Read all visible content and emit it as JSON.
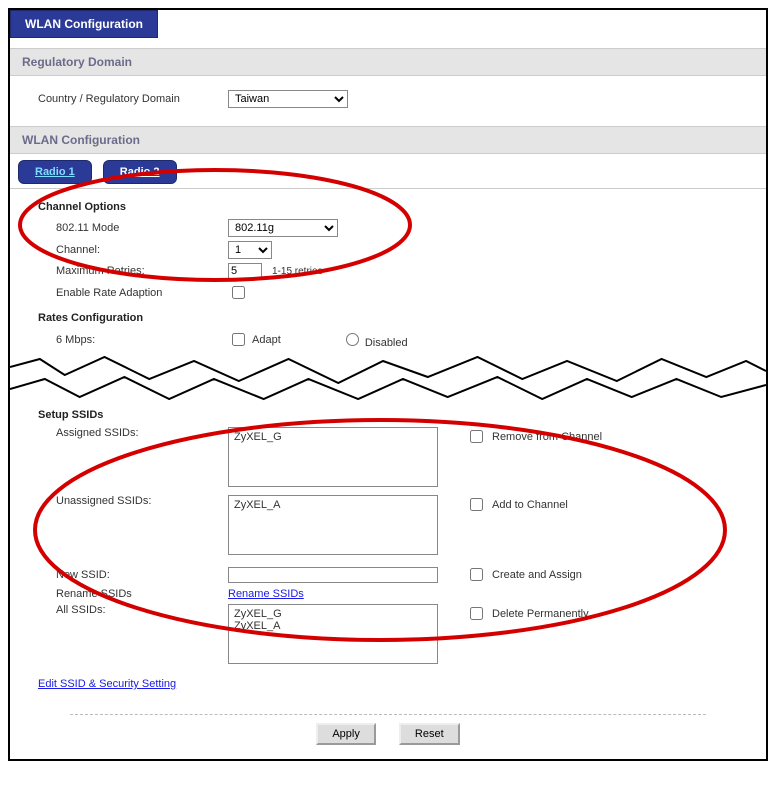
{
  "main_tab": "WLAN Configuration",
  "regulatory": {
    "header": "Regulatory Domain",
    "country_label": "Country / Regulatory Domain",
    "country_value": "Taiwan"
  },
  "wlan": {
    "header": "WLAN Configuration",
    "tabs": {
      "radio1": "Radio 1",
      "radio2": "Radio 2"
    },
    "channel_options": {
      "header": "Channel Options",
      "mode_label": "802.11 Mode",
      "mode_value": "802.11g",
      "channel_label": "Channel:",
      "channel_value": "1",
      "max_retries_label": "Maximum Retries:",
      "max_retries_value": "5",
      "max_retries_hint": "1-15 retries",
      "rate_adapt_label": "Enable Rate Adaption"
    },
    "rates": {
      "header": "Rates Configuration",
      "rate6_label": "6 Mbps:",
      "adapt_label": "Adapt",
      "disabled_label": "Disabled"
    },
    "ssids": {
      "header": "Setup SSIDs",
      "assigned_label": "Assigned SSIDs:",
      "assigned_list": "ZyXEL_G",
      "remove_label": "Remove from Channel",
      "unassigned_label": "Unassigned SSIDs:",
      "unassigned_list": "ZyXEL_A",
      "add_label": "Add to Channel",
      "new_label": "New SSID:",
      "new_value": "",
      "create_label": "Create and Assign",
      "rename_label": "Rename SSIDs",
      "rename_link": "Rename SSIDs",
      "all_label": "All SSIDs:",
      "all_list": "ZyXEL_G\nZyXEL_A",
      "delete_label": "Delete Permanently",
      "edit_link": "Edit SSID & Security Setting"
    }
  },
  "buttons": {
    "apply": "Apply",
    "reset": "Reset"
  }
}
